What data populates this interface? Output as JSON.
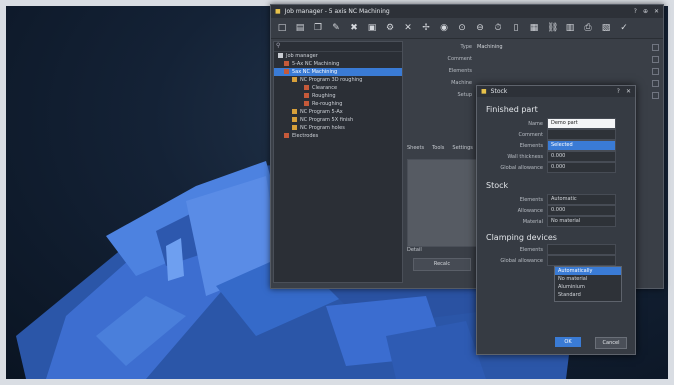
{
  "job_manager": {
    "title": "Job manager - 5 axis NC Machining",
    "search_icon": "search-icon",
    "tree": {
      "root": "Job manager",
      "items": [
        {
          "label": "5-Ax NC Machining",
          "selected": false
        },
        {
          "label": "5ax NC Machining",
          "selected": true
        },
        {
          "label": "NC Program 3D roughing",
          "selected": false
        },
        {
          "label": "Clearance",
          "selected": false
        },
        {
          "label": "Roughing",
          "selected": false
        },
        {
          "label": "Re-roughing",
          "selected": false
        },
        {
          "label": "NC Program 5-Ax",
          "selected": false
        },
        {
          "label": "NC Program 5X finish",
          "selected": false
        },
        {
          "label": "NC Program holes",
          "selected": false
        },
        {
          "label": "Electrodes",
          "selected": false
        }
      ]
    },
    "props": [
      {
        "label": "Type",
        "value": "Machining"
      },
      {
        "label": "Comment",
        "value": ""
      },
      {
        "label": "Elements",
        "value": ""
      },
      {
        "label": "Machine",
        "value": ""
      },
      {
        "label": "Setup",
        "value": ""
      }
    ],
    "tabs": [
      "Sheets",
      "Tools",
      "Settings"
    ],
    "detail_label": "Detail",
    "bottom_button": "Recalc"
  },
  "stock_dialog": {
    "title": "Stock",
    "section_finished": "Finished part",
    "finished_fields": [
      {
        "label": "Name",
        "value": "Demo part",
        "style": "white"
      },
      {
        "label": "Comment",
        "value": "",
        "style": "dark"
      },
      {
        "label": "Elements",
        "value": "Selected",
        "style": "blue"
      },
      {
        "label": "Wall thickness",
        "value": "0.000",
        "style": "dark"
      },
      {
        "label": "Global allowance",
        "value": "0.000",
        "style": "dark"
      }
    ],
    "section_stock": "Stock",
    "stock_fields": [
      {
        "label": "Elements",
        "value": "Automatic",
        "style": "dark"
      },
      {
        "label": "Allowance",
        "value": "0.000",
        "style": "dark"
      },
      {
        "label": "Material",
        "value": "No material",
        "style": "dark"
      }
    ],
    "section_clamping": "Clamping devices",
    "clamping_fields": [
      {
        "label": "Elements",
        "value": "",
        "style": "dark"
      },
      {
        "label": "Global allowance",
        "value": "",
        "style": "dark"
      }
    ],
    "dropdown_options": [
      "Automatically",
      "No material",
      "Aluminium",
      "Standard"
    ],
    "ok_label": "OK",
    "cancel_label": "Cancel"
  }
}
